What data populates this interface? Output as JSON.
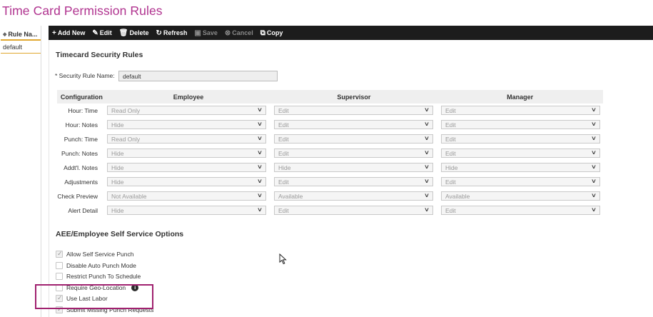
{
  "page": {
    "title": "Time Card Permission Rules"
  },
  "left_panel": {
    "header": "Rule Na...",
    "rows": [
      "default"
    ]
  },
  "toolbar": {
    "add": "Add New",
    "edit": "Edit",
    "delete": "Delete",
    "refresh": "Refresh",
    "save": "Save",
    "cancel": "Cancel",
    "copy": "Copy"
  },
  "security": {
    "section_title": "Timecard Security Rules",
    "rule_name_label": "* Security Rule Name:",
    "rule_name_value": "default"
  },
  "grid": {
    "headers": [
      "Configuration",
      "Employee",
      "Supervisor",
      "Manager"
    ],
    "rows": [
      {
        "label": "Hour: Time",
        "employee": "Read Only",
        "supervisor": "Edit",
        "manager": "Edit"
      },
      {
        "label": "Hour: Notes",
        "employee": "Hide",
        "supervisor": "Edit",
        "manager": "Edit"
      },
      {
        "label": "Punch: Time",
        "employee": "Read Only",
        "supervisor": "Edit",
        "manager": "Edit"
      },
      {
        "label": "Punch: Notes",
        "employee": "Hide",
        "supervisor": "Edit",
        "manager": "Edit"
      },
      {
        "label": "Addt'l. Notes",
        "employee": "Hide",
        "supervisor": "Hide",
        "manager": "Hide"
      },
      {
        "label": "Adjustments",
        "employee": "Hide",
        "supervisor": "Edit",
        "manager": "Edit"
      },
      {
        "label": "Check Preview",
        "employee": "Not Available",
        "supervisor": "Available",
        "manager": "Available"
      },
      {
        "label": "Alert Detail",
        "employee": "Hide",
        "supervisor": "Edit",
        "manager": "Edit"
      }
    ]
  },
  "self_service": {
    "section_title": "AEE/Employee Self Service Options",
    "options": [
      {
        "label": "Allow Self Service Punch",
        "checked": true
      },
      {
        "label": "Disable Auto Punch Mode",
        "checked": false
      },
      {
        "label": "Restrict Punch To Schedule",
        "checked": false
      },
      {
        "label": "Require Geo-Location",
        "checked": false
      },
      {
        "label": "Use Last Labor",
        "checked": true
      },
      {
        "label": "Submit Missing Punch Requests",
        "checked": true
      }
    ]
  },
  "colors": {
    "title": "#b0338f",
    "toolbar_bg": "#1c1c1c",
    "tab_underline": "#e0a72f",
    "highlight": "#a0216f"
  },
  "icons": {
    "add": "plus-icon",
    "edit": "edit-icon",
    "delete": "trash-icon",
    "refresh": "refresh-icon",
    "save": "save-icon",
    "cancel": "cancel-icon",
    "copy": "copy-icon",
    "info": "info-icon"
  }
}
